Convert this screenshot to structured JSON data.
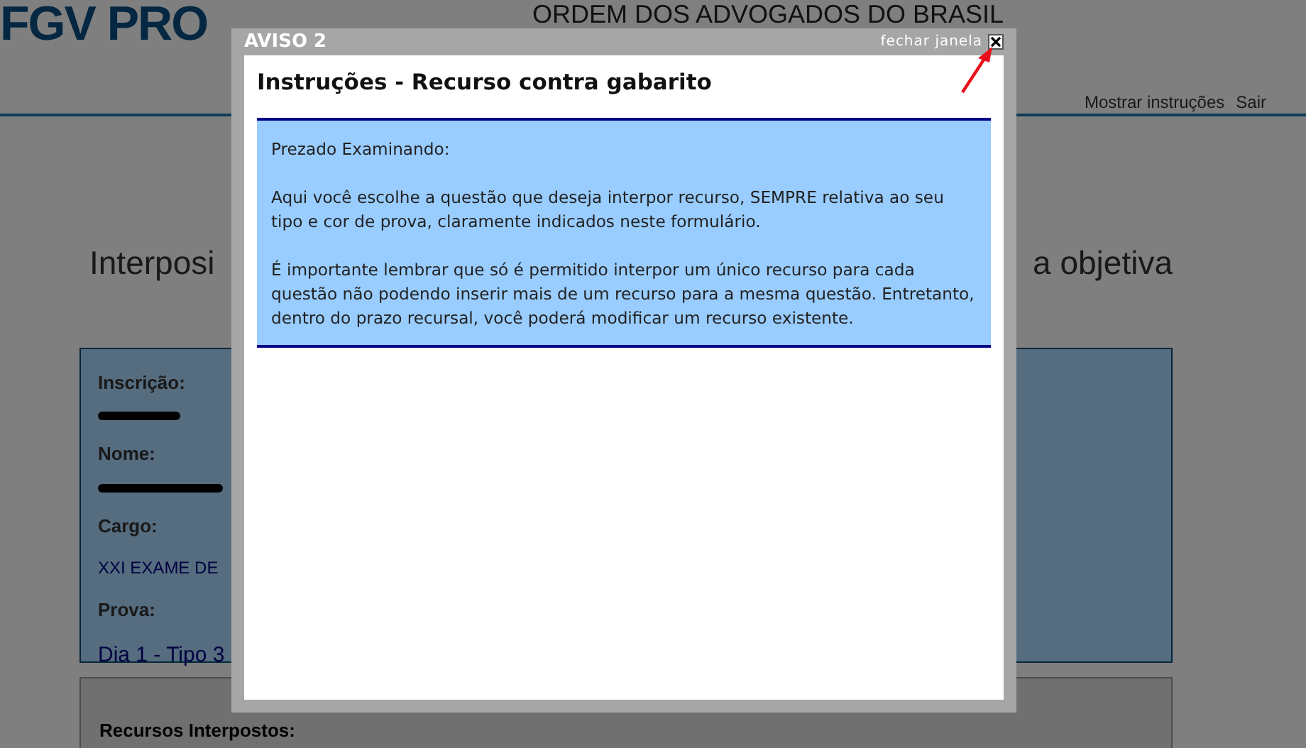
{
  "page": {
    "logo": "FGV PRO",
    "org_title": "ORDEM DOS ADVOGADOS DO BRASIL",
    "nav_links": [
      "Mostrar instruções",
      "Sair"
    ],
    "heading_left": "Interposi",
    "heading_right": "a objetiva",
    "candidate_fields": [
      {
        "label": "Inscrição:",
        "kind": "redacted"
      },
      {
        "label": "Nome:",
        "kind": "redacted"
      },
      {
        "label": "Cargo:",
        "kind": "text",
        "value": "XXI EXAME DE"
      },
      {
        "label": "Prova:",
        "kind": "large",
        "value": "Dia 1 - Tipo 3"
      }
    ],
    "section_title": "Recursos Interpostos:"
  },
  "modal": {
    "window_title": "AVISO 2",
    "close_label": "fechar janela",
    "title": "Instruções - Recurso contra gabarito",
    "paragraphs": [
      "Prezado Examinando:",
      "Aqui você escolhe a questão que deseja interpor recurso, SEMPRE relativa ao seu tipo e cor de prova, claramente indicados neste formulário.",
      "É importante lembrar que só é permitido interpor um único recurso para cada questão não podendo inserir mais de um recurso para a mesma questão. Entretanto, dentro do prazo recursal, você poderá modificar um recurso existente."
    ]
  }
}
